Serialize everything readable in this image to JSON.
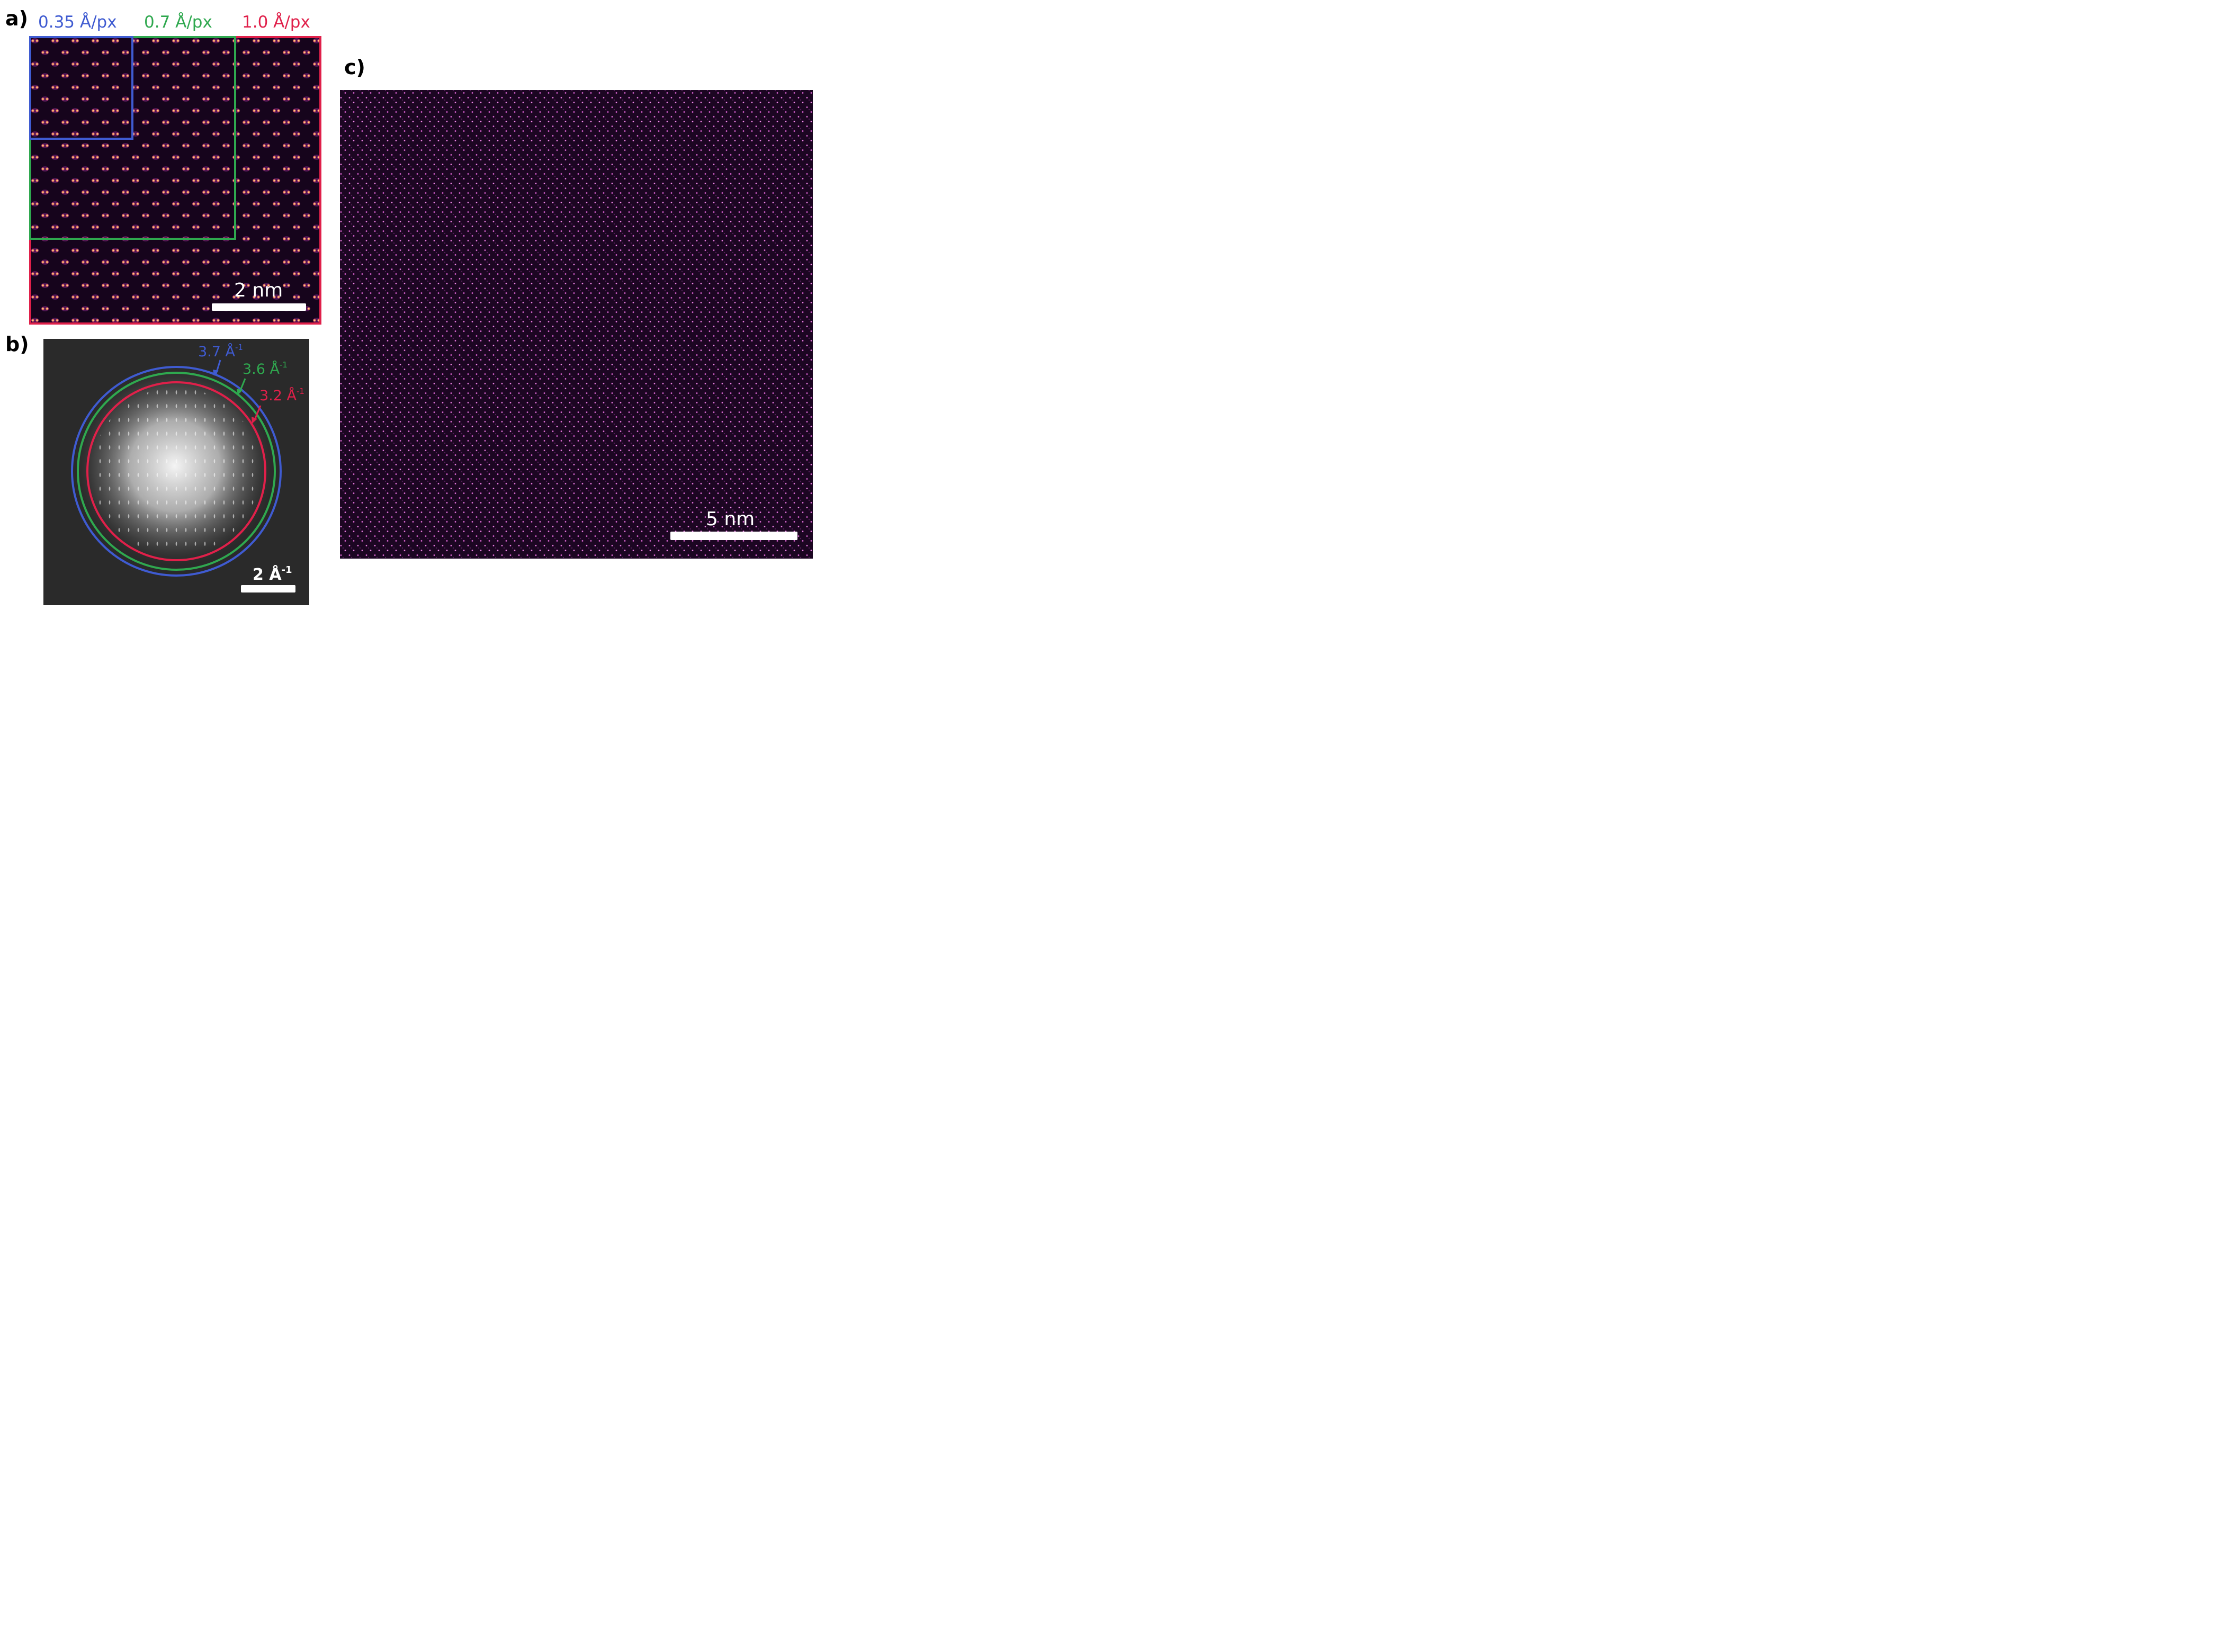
{
  "panels": {
    "a": {
      "label": "a)",
      "resolutions": [
        {
          "text": "0.35 Å/px",
          "color": "#3f5bd1"
        },
        {
          "text": "0.7 Å/px",
          "color": "#2fa84f"
        },
        {
          "text": "1.0 Å/px",
          "color": "#e0204a"
        }
      ],
      "scale_bar": "2 nm"
    },
    "b": {
      "label": "b)",
      "rings": [
        {
          "value": "3.7 Å",
          "exponent": "-1",
          "color": "#3f5bd1"
        },
        {
          "value": "3.6 Å",
          "exponent": "-1",
          "color": "#2fa84f"
        },
        {
          "value": "3.2 Å",
          "exponent": "-1",
          "color": "#e0204a"
        }
      ],
      "scale_bar": "2 Å",
      "scale_bar_exponent": "-1"
    },
    "c": {
      "label": "c)",
      "scale_bar": "5 nm"
    }
  },
  "colors": {
    "lattice_bg": "#1a0620",
    "lattice_atom": "#f2a8ff",
    "fft_bg": "#2a2a2a"
  }
}
